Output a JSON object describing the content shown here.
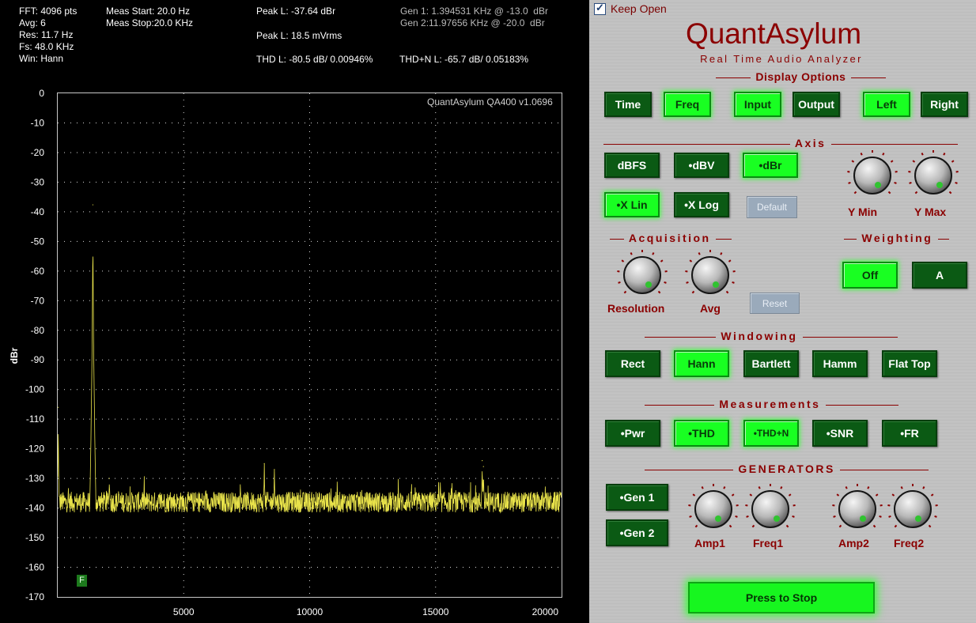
{
  "display": {
    "header": {
      "fft": "FFT: 4096 pts",
      "avg": "Avg: 6",
      "res": "Res: 11.7 Hz",
      "fs": "Fs: 48.0 KHz",
      "win": "Win: Hann",
      "meas_start": "Meas Start: 20.0 Hz",
      "meas_stop": "Meas Stop:20.0 KHz",
      "peak_dbr": "Peak L: -37.64 dBr",
      "peak_vrms": "Peak L: 18.5 mVrms",
      "thd": "THD L: -80.5 dB/ 0.00946%",
      "thdn": "THD+N L: -65.7 dB/ 0.05183%",
      "gen1": "Gen 1: 1.394531 KHz @ -13.0  dBr",
      "gen2": "Gen 2:11.97656 KHz @ -20.0  dBr"
    },
    "watermark": "QuantAsylum QA400 v1.0696",
    "marker_label": "F"
  },
  "chart_data": {
    "type": "line",
    "ylabel": "dBr",
    "xlabel": "",
    "xlim": [
      0,
      20000
    ],
    "ylim": [
      -170,
      0
    ],
    "x_ticks": [
      5000,
      10000,
      15000,
      20000
    ],
    "y_ticks": [
      0,
      -10,
      -20,
      -30,
      -40,
      -50,
      -60,
      -70,
      -80,
      -90,
      -100,
      -110,
      -120,
      -130,
      -140,
      -150,
      -160,
      -170
    ],
    "grid": true,
    "series": [
      {
        "color": "#e8e24a",
        "noise_floor": -138,
        "peaks": [
          {
            "x": 20,
            "y": -106
          },
          {
            "x": 1395,
            "y": -37.64
          },
          {
            "x": 2050,
            "y": -130
          },
          {
            "x": 8200,
            "y": -125
          },
          {
            "x": 8600,
            "y": -127
          },
          {
            "x": 16900,
            "y": -126
          },
          {
            "x": 16850,
            "y": -124
          }
        ]
      }
    ]
  },
  "panel": {
    "keep_open": "Keep Open",
    "brand": "QuantAsylum",
    "subtitle": "Real Time Audio Analyzer",
    "sections": {
      "display": "Display Options",
      "axis": "Axis",
      "acquisition": "Acquisition",
      "weighting": "Weighting",
      "windowing": "Windowing",
      "measurements": "Measurements",
      "generators": "GENERATORS"
    },
    "display_buttons": {
      "time": "Time",
      "freq": "Freq",
      "input": "Input",
      "output": "Output",
      "left": "Left",
      "right": "Right"
    },
    "axis_buttons": {
      "dbfs": "dBFS",
      "dbv": "•dBV",
      "dbr": "•dBr",
      "xlin": "•X Lin",
      "xlog": "•X Log",
      "default": "Default"
    },
    "axis_knobs": {
      "ymin": "Y Min",
      "ymax": "Y Max"
    },
    "acq_knobs": {
      "resolution": "Resolution",
      "avg": "Avg"
    },
    "reset": "Reset",
    "weighting_buttons": {
      "off": "Off",
      "a": "A"
    },
    "window_buttons": {
      "rect": "Rect",
      "hann": "Hann",
      "bartlett": "Bartlett",
      "hamm": "Hamm",
      "flattop": "Flat Top"
    },
    "meas_buttons": {
      "pwr": "•Pwr",
      "thd": "•THD",
      "thdn": "•THD+N",
      "snr": "•SNR",
      "fr": "•FR"
    },
    "gen_buttons": {
      "gen1": "•Gen 1",
      "gen2": "•Gen 2"
    },
    "gen_knobs": {
      "amp1": "Amp1",
      "freq1": "Freq1",
      "amp2": "Amp2",
      "freq2": "Freq2"
    },
    "stop": "Press to Stop"
  }
}
